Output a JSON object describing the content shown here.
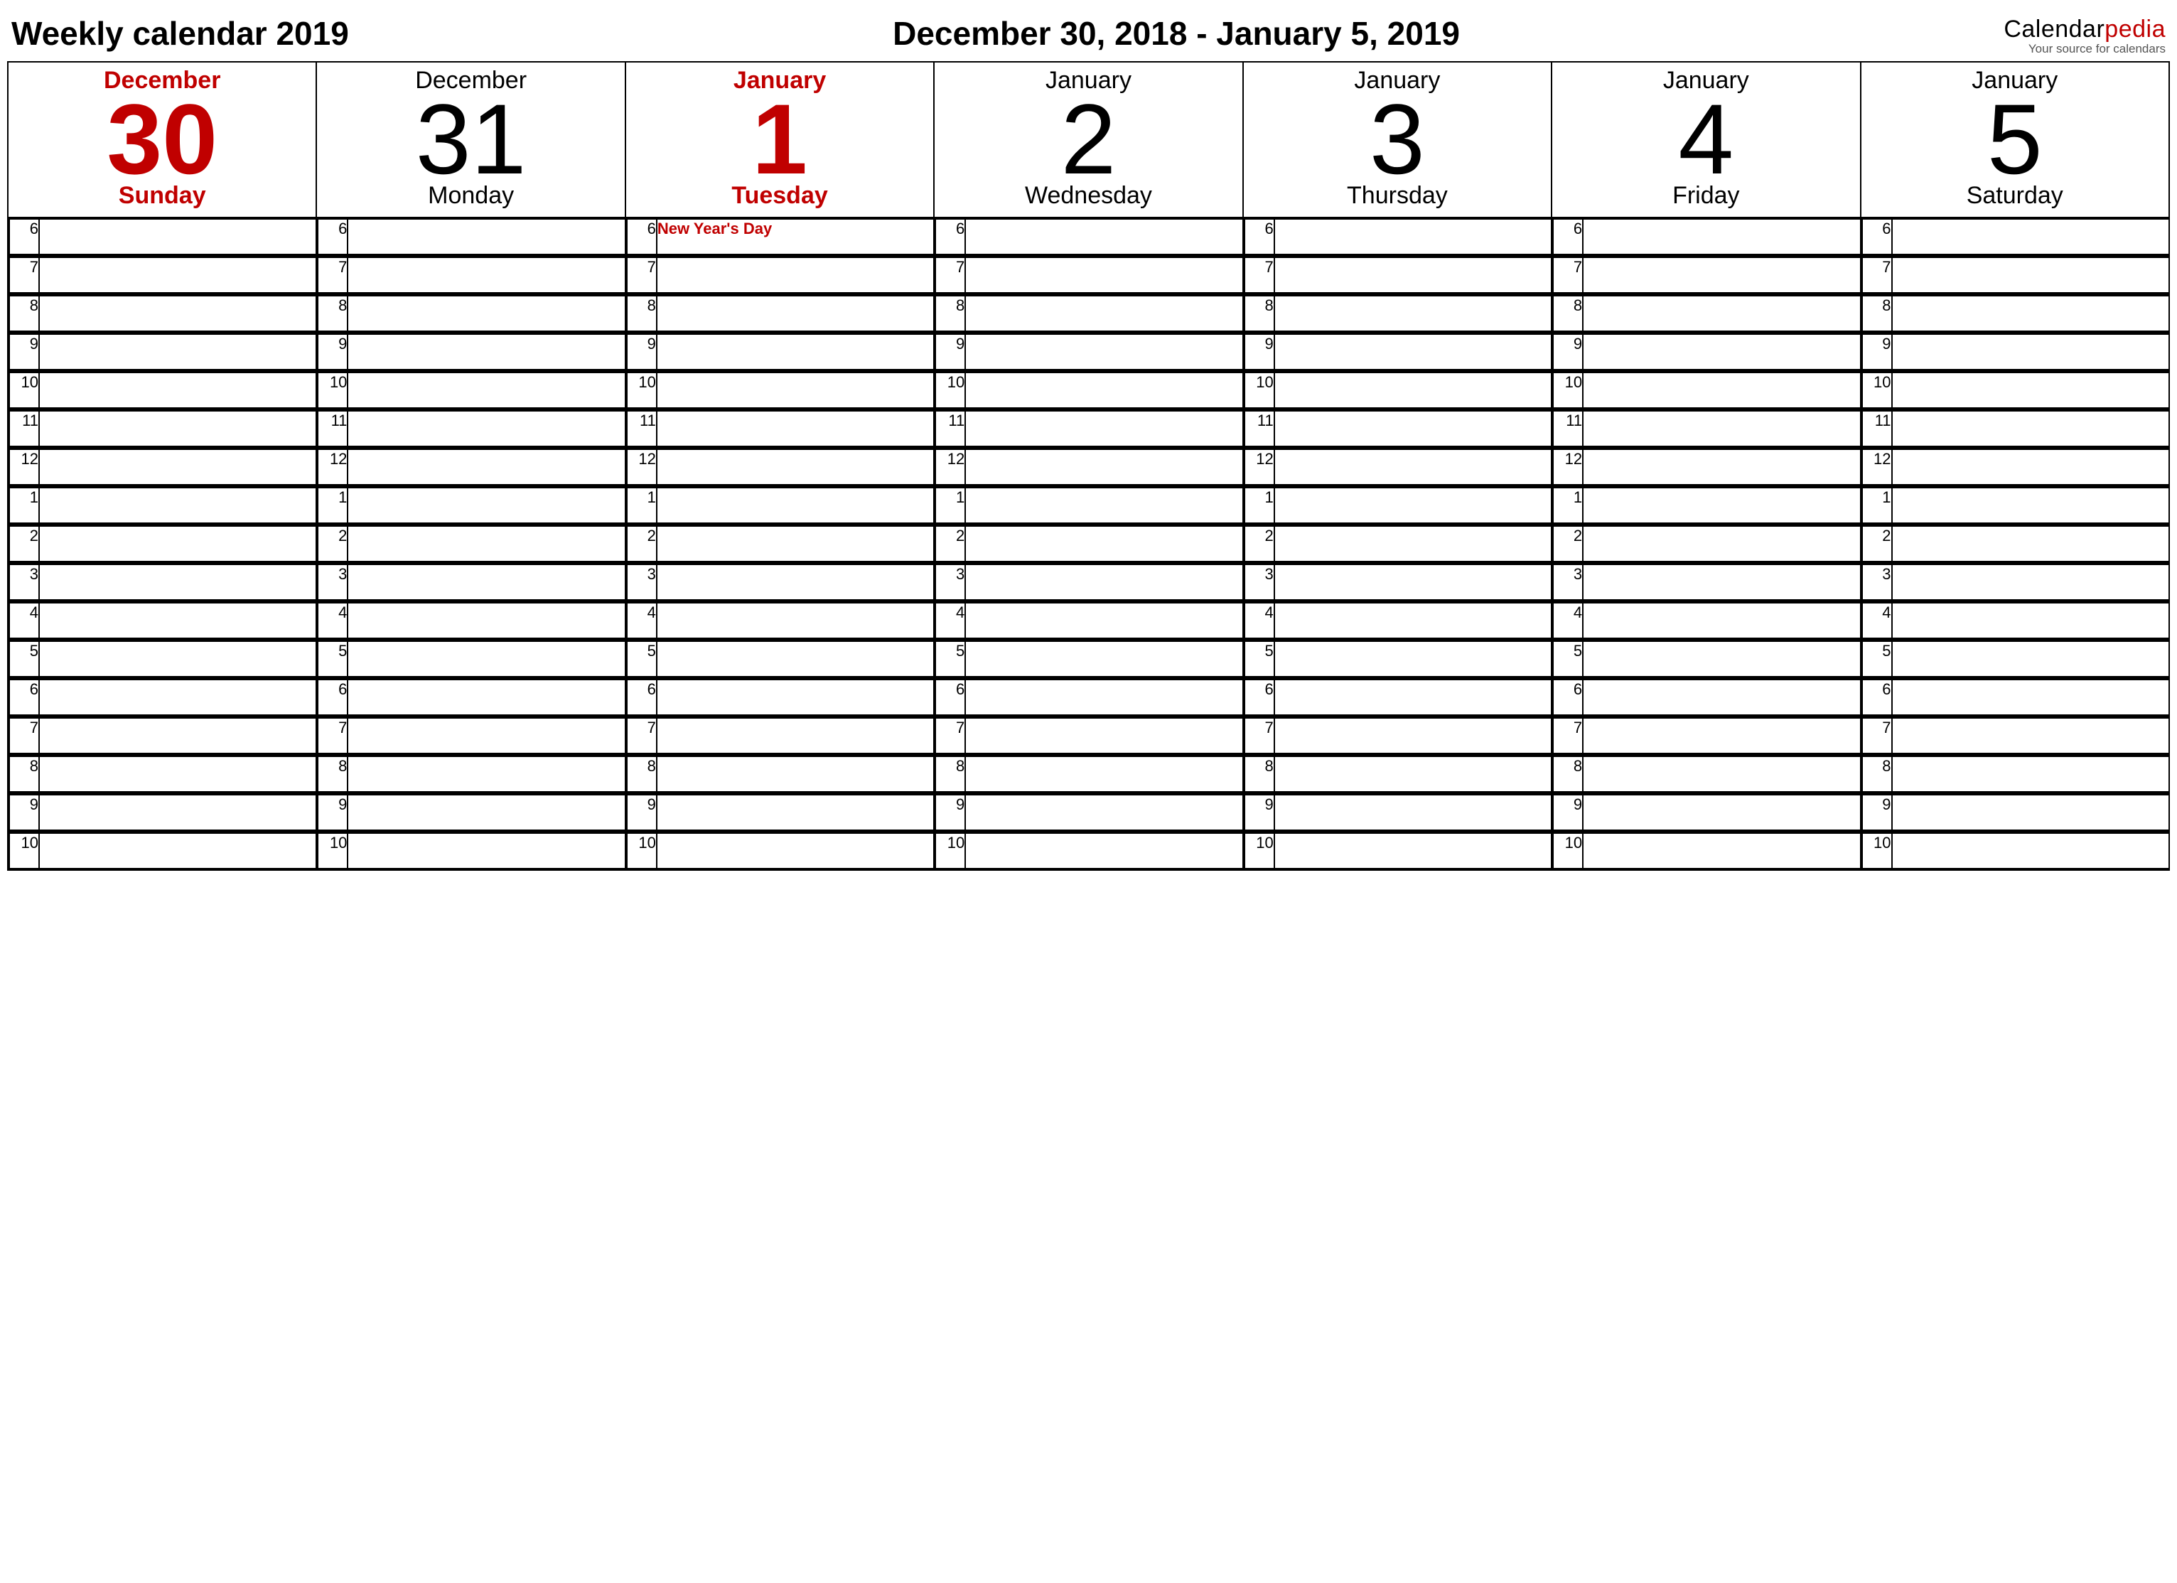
{
  "header": {
    "title_left": "Weekly calendar 2019",
    "title_center": "December 30, 2018 - January 5, 2019",
    "brand_part1": "Calendar",
    "brand_part2": "pedia",
    "brand_tag": "Your source for calendars"
  },
  "hours": [
    "6",
    "7",
    "8",
    "9",
    "10",
    "11",
    "12",
    "1",
    "2",
    "3",
    "4",
    "5",
    "6",
    "7",
    "8",
    "9",
    "10"
  ],
  "days": [
    {
      "month": "December",
      "num": "30",
      "weekday": "Sunday",
      "red": true,
      "events": {}
    },
    {
      "month": "December",
      "num": "31",
      "weekday": "Monday",
      "red": false,
      "events": {}
    },
    {
      "month": "January",
      "num": "1",
      "weekday": "Tuesday",
      "red": true,
      "events": {
        "0": "New Year's Day"
      }
    },
    {
      "month": "January",
      "num": "2",
      "weekday": "Wednesday",
      "red": false,
      "events": {}
    },
    {
      "month": "January",
      "num": "3",
      "weekday": "Thursday",
      "red": false,
      "events": {}
    },
    {
      "month": "January",
      "num": "4",
      "weekday": "Friday",
      "red": false,
      "events": {}
    },
    {
      "month": "January",
      "num": "5",
      "weekday": "Saturday",
      "red": false,
      "events": {}
    }
  ]
}
